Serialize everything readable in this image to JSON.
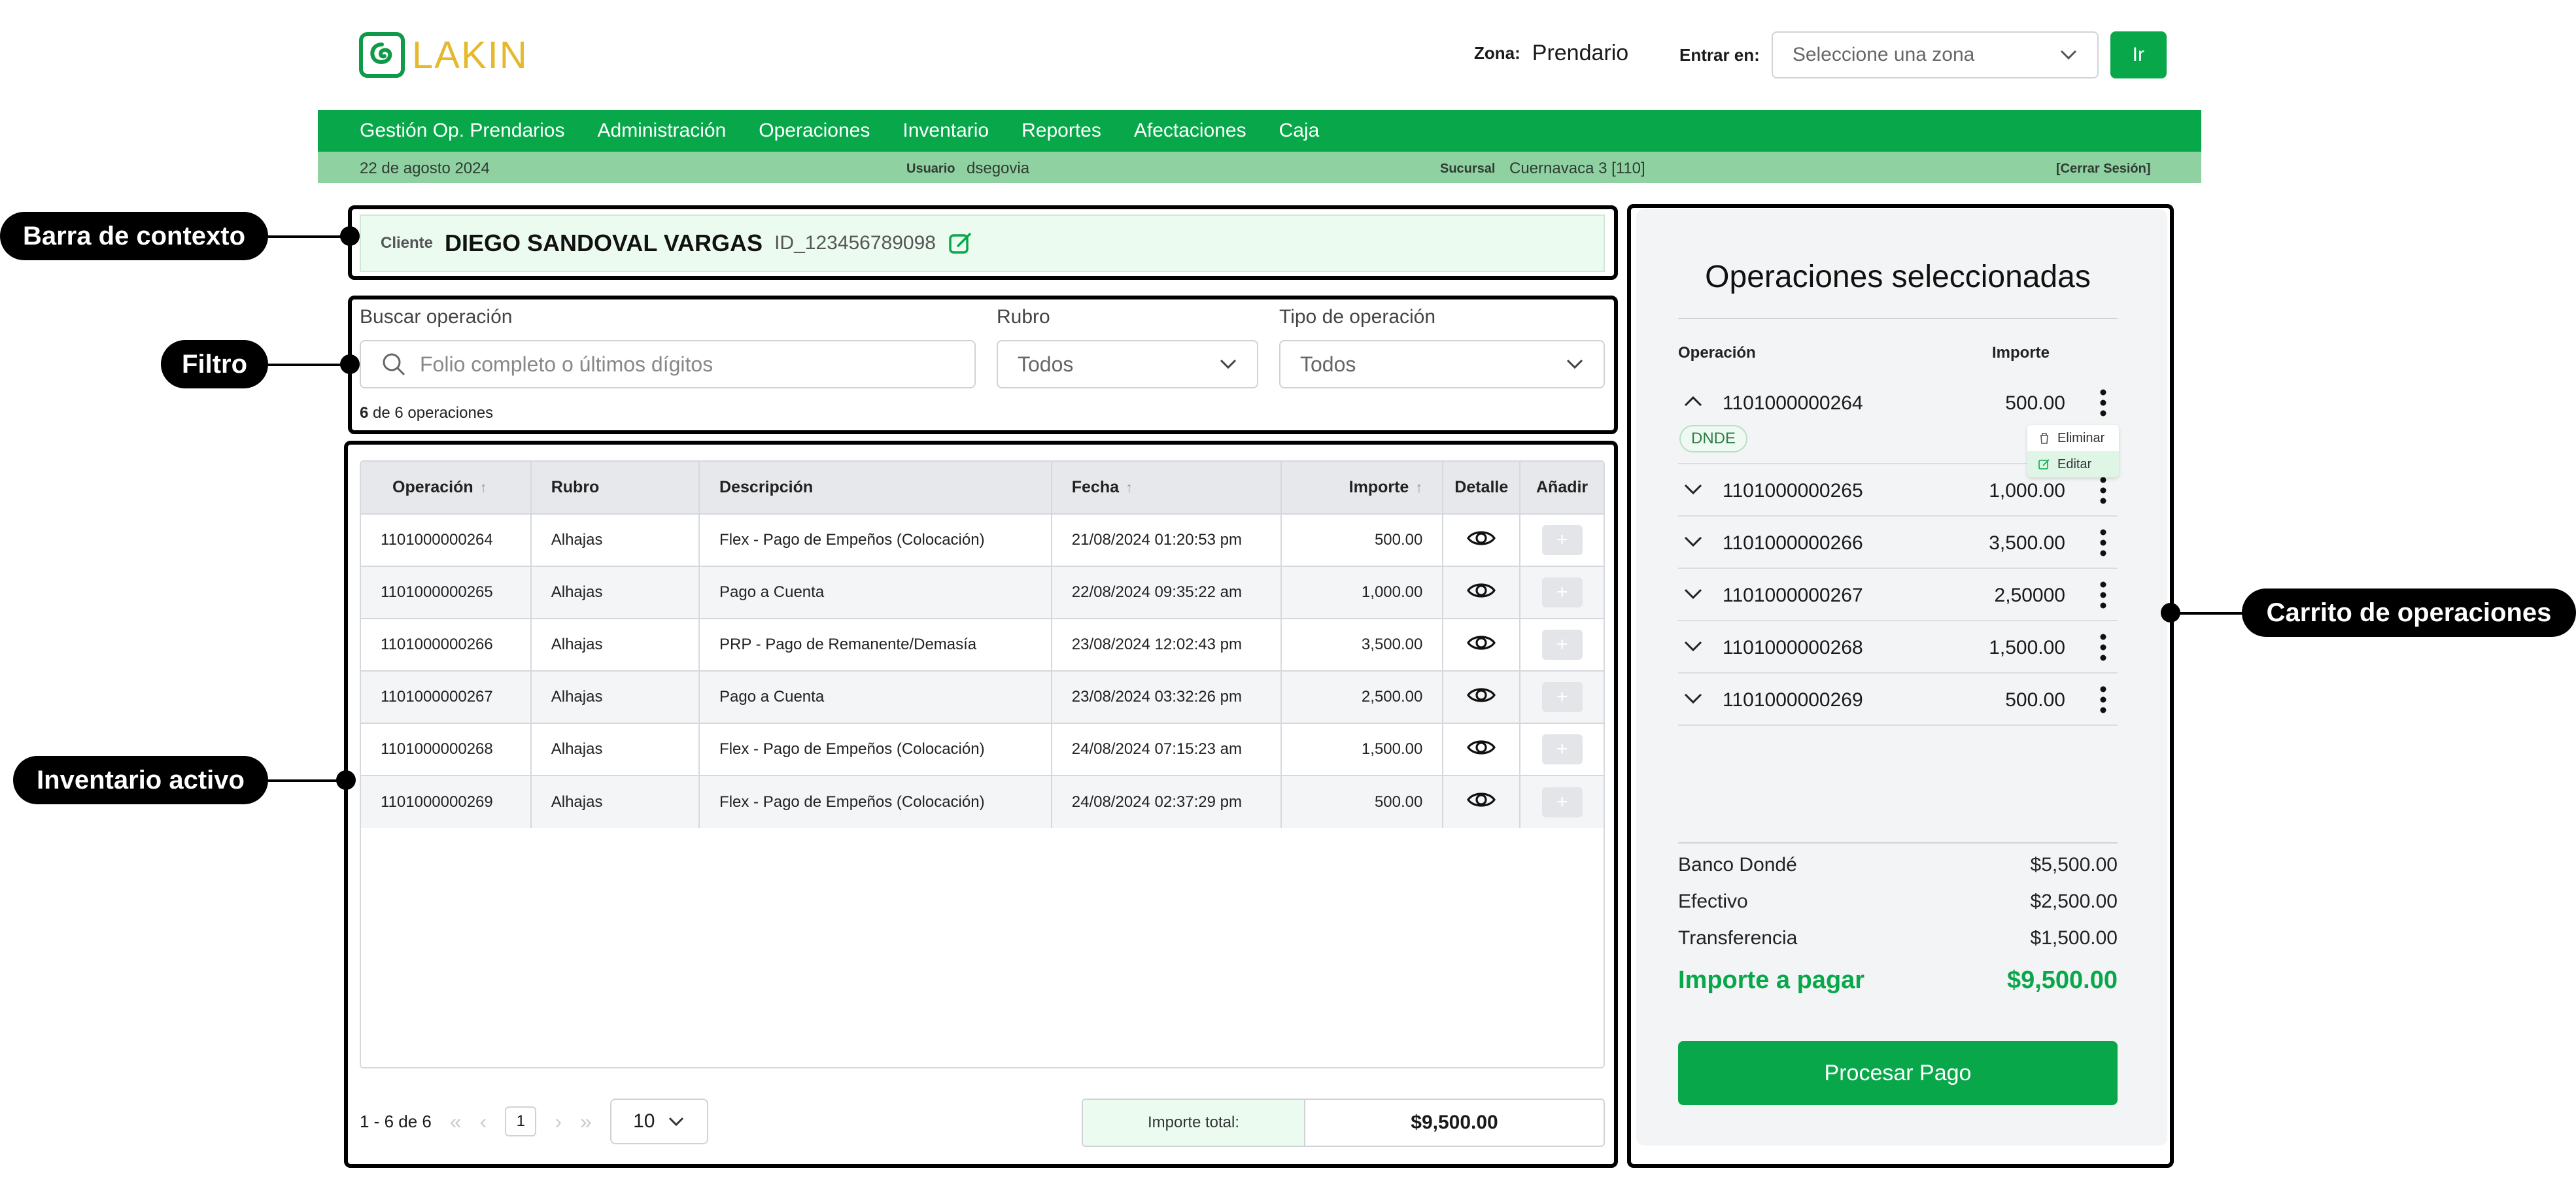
{
  "header": {
    "brand": "LAKIN",
    "zona_label": "Zona:",
    "zona_value": "Prendario",
    "entrar_label": "Entrar en:",
    "zona_select_placeholder": "Seleccione una zona",
    "ir_label": "Ir"
  },
  "nav": {
    "items": [
      "Gestión Op. Prendarios",
      "Administración",
      "Operaciones",
      "Inventario",
      "Reportes",
      "Afectaciones",
      "Caja"
    ]
  },
  "subbar": {
    "date": "22 de agosto 2024",
    "usuario_label": "Usuario",
    "usuario_value": "dsegovia",
    "sucursal_label": "Sucursal",
    "sucursal_value": "Cuernavaca 3 [110]",
    "logout": "[Cerrar Sesión]"
  },
  "annotations": {
    "context": "Barra de contexto",
    "filter": "Filtro",
    "inventory": "Inventario activo",
    "cart": "Carrito de operaciones"
  },
  "context": {
    "client_label": "Cliente",
    "client_name": "DIEGO SANDOVAL VARGAS",
    "client_id": "ID_123456789098"
  },
  "filter": {
    "search_label": "Buscar operación",
    "search_placeholder": "Folio completo o últimos dígitos",
    "rubro_label": "Rubro",
    "rubro_value": "Todos",
    "tipo_label": "Tipo de operación",
    "tipo_value": "Todos",
    "count_bold": "6",
    "count_text": "de 6 operaciones"
  },
  "table": {
    "columns": [
      "Operación",
      "Rubro",
      "Descripción",
      "Fecha",
      "Importe",
      "Detalle",
      "Añadir"
    ],
    "rows": [
      {
        "op": "1101000000264",
        "rubro": "Alhajas",
        "desc": "Flex - Pago de Empeños (Colocación)",
        "fecha": "21/08/2024 01:20:53 pm",
        "importe": "500.00"
      },
      {
        "op": "1101000000265",
        "rubro": "Alhajas",
        "desc": "Pago a Cuenta",
        "fecha": "22/08/2024 09:35:22 am",
        "importe": "1,000.00"
      },
      {
        "op": "1101000000266",
        "rubro": "Alhajas",
        "desc": "PRP - Pago de Remanente/Demasía",
        "fecha": "23/08/2024 12:02:43 pm",
        "importe": "3,500.00"
      },
      {
        "op": "1101000000267",
        "rubro": "Alhajas",
        "desc": "Pago a Cuenta",
        "fecha": "23/08/2024 03:32:26 pm",
        "importe": "2,500.00"
      },
      {
        "op": "1101000000268",
        "rubro": "Alhajas",
        "desc": "Flex - Pago de Empeños (Colocación)",
        "fecha": "24/08/2024 07:15:23 am",
        "importe": "1,500.00"
      },
      {
        "op": "1101000000269",
        "rubro": "Alhajas",
        "desc": "Flex - Pago de Empeños (Colocación)",
        "fecha": "24/08/2024 02:37:29 pm",
        "importe": "500.00"
      }
    ],
    "add_symbol": "+"
  },
  "pager": {
    "range": "1 - 6 de 6",
    "page": "1",
    "page_size": "10",
    "total_label": "Importe total:",
    "total_value": "$9,500.00"
  },
  "cart": {
    "title": "Operaciones seleccionadas",
    "col_op": "Operación",
    "col_importe": "Importe",
    "items": [
      {
        "op": "1101000000264",
        "amount": "500.00"
      },
      {
        "op": "1101000000265",
        "amount": "1,000.00"
      },
      {
        "op": "1101000000266",
        "amount": "3,500.00"
      },
      {
        "op": "1101000000267",
        "amount": "2,50000"
      },
      {
        "op": "1101000000268",
        "amount": "1,500.00"
      },
      {
        "op": "1101000000269",
        "amount": "500.00"
      }
    ],
    "tag": "DNDE",
    "menu_delete": "Eliminar",
    "menu_edit": "Editar",
    "summary": [
      {
        "label": "Banco Dondé",
        "value": "$5,500.00"
      },
      {
        "label": "Efectivo",
        "value": "$2,500.00"
      },
      {
        "label": "Transferencia",
        "value": "$1,500.00"
      }
    ],
    "total_label": "Importe a pagar",
    "total_value": "$9,500.00",
    "process_label": "Procesar Pago"
  },
  "colors": {
    "brand_green": "#08a84a",
    "logo_yellow": "#e4b92e",
    "subbar_green": "#8fd1a1"
  }
}
